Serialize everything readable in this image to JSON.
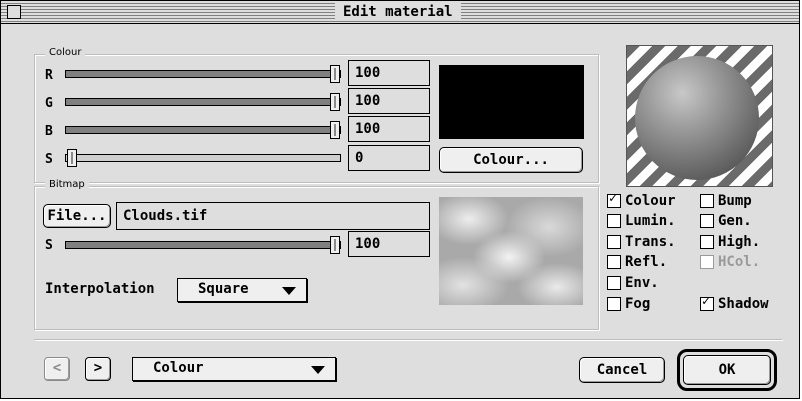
{
  "window": {
    "title": "Edit material"
  },
  "colour_group": {
    "title": "Colour",
    "sliders": [
      {
        "label": "R",
        "value": "100",
        "level": 1.0
      },
      {
        "label": "G",
        "value": "100",
        "level": 1.0
      },
      {
        "label": "B",
        "value": "100",
        "level": 1.0
      },
      {
        "label": "S",
        "value": "0",
        "level": 0.0
      }
    ],
    "colour_button": "Colour...",
    "swatch_color": "#000000"
  },
  "bitmap_group": {
    "title": "Bitmap",
    "file_button": "File...",
    "filename": "Clouds.tif",
    "slider": {
      "label": "S",
      "value": "100",
      "level": 1.0
    },
    "interpolation_label": "Interpolation",
    "interpolation_value": "Square"
  },
  "checkboxes": {
    "colour": {
      "label": "Colour",
      "checked": true
    },
    "lumin": {
      "label": "Lumin.",
      "checked": false
    },
    "trans": {
      "label": "Trans.",
      "checked": false
    },
    "refl": {
      "label": "Refl.",
      "checked": false
    },
    "env": {
      "label": "Env.",
      "checked": false
    },
    "fog": {
      "label": "Fog",
      "checked": false
    },
    "bump": {
      "label": "Bump",
      "checked": false
    },
    "gen": {
      "label": "Gen.",
      "checked": false
    },
    "high": {
      "label": "High.",
      "checked": false
    },
    "hcol": {
      "label": "HCol.",
      "checked": false,
      "disabled": true
    },
    "shadow": {
      "label": "Shadow",
      "checked": true
    }
  },
  "footer": {
    "prev_label": "<",
    "next_label": ">",
    "channel_value": "Colour",
    "cancel_label": "Cancel",
    "ok_label": "OK"
  },
  "icons": {
    "check": "✓"
  }
}
